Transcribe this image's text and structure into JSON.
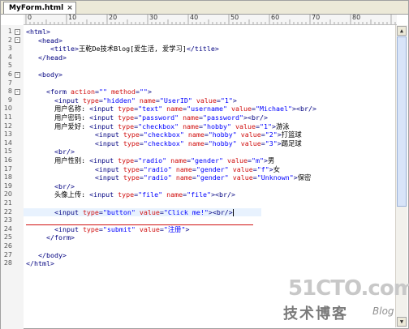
{
  "tab": {
    "title": "MyForm.html",
    "close_glyph": "×"
  },
  "ruler": {
    "labels": [
      "0",
      "10",
      "20",
      "30",
      "40",
      "50",
      "60",
      "70",
      "80"
    ]
  },
  "lines": [
    {
      "n": "1",
      "fold": "-",
      "segs": [
        {
          "c": "tag",
          "t": "<html>"
        }
      ]
    },
    {
      "n": "2",
      "fold": "-",
      "segs": [
        {
          "c": "text",
          "t": "   "
        },
        {
          "c": "tag",
          "t": "<head>"
        }
      ]
    },
    {
      "n": "3",
      "fold": "",
      "segs": [
        {
          "c": "text",
          "t": "      "
        },
        {
          "c": "tag",
          "t": "<title>"
        },
        {
          "c": "text",
          "t": "王乾De技术Blog[爱生活, 爱学习]"
        },
        {
          "c": "tag",
          "t": "</title>"
        }
      ]
    },
    {
      "n": "4",
      "fold": "",
      "segs": [
        {
          "c": "text",
          "t": "   "
        },
        {
          "c": "tag",
          "t": "</head>"
        }
      ]
    },
    {
      "n": "5",
      "fold": "",
      "segs": []
    },
    {
      "n": "6",
      "fold": "-",
      "segs": [
        {
          "c": "text",
          "t": "   "
        },
        {
          "c": "tag",
          "t": "<body>"
        }
      ]
    },
    {
      "n": "7",
      "fold": "",
      "segs": []
    },
    {
      "n": "8",
      "fold": "-",
      "segs": [
        {
          "c": "text",
          "t": "     "
        },
        {
          "c": "tag",
          "t": "<form "
        },
        {
          "c": "attr",
          "t": "action"
        },
        {
          "c": "tag",
          "t": "="
        },
        {
          "c": "val",
          "t": "\"\""
        },
        {
          "c": "text",
          "t": " "
        },
        {
          "c": "attr",
          "t": "method"
        },
        {
          "c": "tag",
          "t": "="
        },
        {
          "c": "val",
          "t": "\"\""
        },
        {
          "c": "tag",
          "t": ">"
        }
      ]
    },
    {
      "n": "9",
      "fold": "",
      "segs": [
        {
          "c": "text",
          "t": "       "
        },
        {
          "c": "tag",
          "t": "<input "
        },
        {
          "c": "attr",
          "t": "type"
        },
        {
          "c": "tag",
          "t": "="
        },
        {
          "c": "val",
          "t": "\"hidden\""
        },
        {
          "c": "text",
          "t": " "
        },
        {
          "c": "attr",
          "t": "name"
        },
        {
          "c": "tag",
          "t": "="
        },
        {
          "c": "val",
          "t": "\"UserID\""
        },
        {
          "c": "text",
          "t": " "
        },
        {
          "c": "attr",
          "t": "value"
        },
        {
          "c": "tag",
          "t": "="
        },
        {
          "c": "val",
          "t": "\"1\""
        },
        {
          "c": "tag",
          "t": ">"
        }
      ]
    },
    {
      "n": "10",
      "fold": "",
      "segs": [
        {
          "c": "text",
          "t": "       用户名称: "
        },
        {
          "c": "tag",
          "t": "<input "
        },
        {
          "c": "attr",
          "t": "type"
        },
        {
          "c": "tag",
          "t": "="
        },
        {
          "c": "val",
          "t": "\"text\""
        },
        {
          "c": "text",
          "t": " "
        },
        {
          "c": "attr",
          "t": "name"
        },
        {
          "c": "tag",
          "t": "="
        },
        {
          "c": "val",
          "t": "\"username\""
        },
        {
          "c": "text",
          "t": " "
        },
        {
          "c": "attr",
          "t": "value"
        },
        {
          "c": "tag",
          "t": "="
        },
        {
          "c": "val",
          "t": "\"Michael\""
        },
        {
          "c": "tag",
          "t": "><br/>"
        }
      ]
    },
    {
      "n": "11",
      "fold": "",
      "segs": [
        {
          "c": "text",
          "t": "       用户密码: "
        },
        {
          "c": "tag",
          "t": "<input "
        },
        {
          "c": "attr",
          "t": "type"
        },
        {
          "c": "tag",
          "t": "="
        },
        {
          "c": "val",
          "t": "\"password\""
        },
        {
          "c": "text",
          "t": " "
        },
        {
          "c": "attr",
          "t": "name"
        },
        {
          "c": "tag",
          "t": "="
        },
        {
          "c": "val",
          "t": "\"password\""
        },
        {
          "c": "tag",
          "t": "><br/>"
        }
      ]
    },
    {
      "n": "12",
      "fold": "",
      "segs": [
        {
          "c": "text",
          "t": "       用户爱好: "
        },
        {
          "c": "tag",
          "t": "<input "
        },
        {
          "c": "attr",
          "t": "type"
        },
        {
          "c": "tag",
          "t": "="
        },
        {
          "c": "val",
          "t": "\"checkbox\""
        },
        {
          "c": "text",
          "t": " "
        },
        {
          "c": "attr",
          "t": "name"
        },
        {
          "c": "tag",
          "t": "="
        },
        {
          "c": "val",
          "t": "\"hobby\""
        },
        {
          "c": "text",
          "t": " "
        },
        {
          "c": "attr",
          "t": "value"
        },
        {
          "c": "tag",
          "t": "="
        },
        {
          "c": "val",
          "t": "\"1\""
        },
        {
          "c": "tag",
          "t": ">"
        },
        {
          "c": "text",
          "t": "游泳"
        }
      ]
    },
    {
      "n": "13",
      "fold": "",
      "segs": [
        {
          "c": "text",
          "t": "                 "
        },
        {
          "c": "tag",
          "t": "<input "
        },
        {
          "c": "attr",
          "t": "type"
        },
        {
          "c": "tag",
          "t": "="
        },
        {
          "c": "val",
          "t": "\"checkbox\""
        },
        {
          "c": "text",
          "t": " "
        },
        {
          "c": "attr",
          "t": "name"
        },
        {
          "c": "tag",
          "t": "="
        },
        {
          "c": "val",
          "t": "\"hobby\""
        },
        {
          "c": "text",
          "t": " "
        },
        {
          "c": "attr",
          "t": "value"
        },
        {
          "c": "tag",
          "t": "="
        },
        {
          "c": "val",
          "t": "\"2\""
        },
        {
          "c": "tag",
          "t": ">"
        },
        {
          "c": "text",
          "t": "打篮球"
        }
      ]
    },
    {
      "n": "14",
      "fold": "",
      "segs": [
        {
          "c": "text",
          "t": "                 "
        },
        {
          "c": "tag",
          "t": "<input "
        },
        {
          "c": "attr",
          "t": "type"
        },
        {
          "c": "tag",
          "t": "="
        },
        {
          "c": "val",
          "t": "\"checkbox\""
        },
        {
          "c": "text",
          "t": " "
        },
        {
          "c": "attr",
          "t": "name"
        },
        {
          "c": "tag",
          "t": "="
        },
        {
          "c": "val",
          "t": "\"hobby\""
        },
        {
          "c": "text",
          "t": " "
        },
        {
          "c": "attr",
          "t": "value"
        },
        {
          "c": "tag",
          "t": "="
        },
        {
          "c": "val",
          "t": "\"3\""
        },
        {
          "c": "tag",
          "t": ">"
        },
        {
          "c": "text",
          "t": "踢足球"
        }
      ]
    },
    {
      "n": "15",
      "fold": "",
      "segs": [
        {
          "c": "text",
          "t": "       "
        },
        {
          "c": "tag",
          "t": "<br/>"
        }
      ]
    },
    {
      "n": "16",
      "fold": "",
      "segs": [
        {
          "c": "text",
          "t": "       用户性别: "
        },
        {
          "c": "tag",
          "t": "<input "
        },
        {
          "c": "attr",
          "t": "type"
        },
        {
          "c": "tag",
          "t": "="
        },
        {
          "c": "val",
          "t": "\"radio\""
        },
        {
          "c": "text",
          "t": " "
        },
        {
          "c": "attr",
          "t": "name"
        },
        {
          "c": "tag",
          "t": "="
        },
        {
          "c": "val",
          "t": "\"gender\""
        },
        {
          "c": "text",
          "t": " "
        },
        {
          "c": "attr",
          "t": "value"
        },
        {
          "c": "tag",
          "t": "="
        },
        {
          "c": "val",
          "t": "\"m\""
        },
        {
          "c": "tag",
          "t": ">"
        },
        {
          "c": "text",
          "t": "男"
        }
      ]
    },
    {
      "n": "17",
      "fold": "",
      "segs": [
        {
          "c": "text",
          "t": "                 "
        },
        {
          "c": "tag",
          "t": "<input "
        },
        {
          "c": "attr",
          "t": "type"
        },
        {
          "c": "tag",
          "t": "="
        },
        {
          "c": "val",
          "t": "\"radio\""
        },
        {
          "c": "text",
          "t": " "
        },
        {
          "c": "attr",
          "t": "name"
        },
        {
          "c": "tag",
          "t": "="
        },
        {
          "c": "val",
          "t": "\"gender\""
        },
        {
          "c": "text",
          "t": " "
        },
        {
          "c": "attr",
          "t": "value"
        },
        {
          "c": "tag",
          "t": "="
        },
        {
          "c": "val",
          "t": "\"f\""
        },
        {
          "c": "tag",
          "t": ">"
        },
        {
          "c": "text",
          "t": "女"
        }
      ]
    },
    {
      "n": "18",
      "fold": "",
      "segs": [
        {
          "c": "text",
          "t": "                 "
        },
        {
          "c": "tag",
          "t": "<input "
        },
        {
          "c": "attr",
          "t": "type"
        },
        {
          "c": "tag",
          "t": "="
        },
        {
          "c": "val",
          "t": "\"radio\""
        },
        {
          "c": "text",
          "t": " "
        },
        {
          "c": "attr",
          "t": "name"
        },
        {
          "c": "tag",
          "t": "="
        },
        {
          "c": "val",
          "t": "\"gender\""
        },
        {
          "c": "text",
          "t": " "
        },
        {
          "c": "attr",
          "t": "value"
        },
        {
          "c": "tag",
          "t": "="
        },
        {
          "c": "val",
          "t": "\"Unknown\""
        },
        {
          "c": "tag",
          "t": ">"
        },
        {
          "c": "text",
          "t": "保密"
        }
      ]
    },
    {
      "n": "19",
      "fold": "",
      "segs": [
        {
          "c": "text",
          "t": "       "
        },
        {
          "c": "tag",
          "t": "<br/>"
        }
      ]
    },
    {
      "n": "20",
      "fold": "",
      "segs": [
        {
          "c": "text",
          "t": "       头像上传: "
        },
        {
          "c": "tag",
          "t": "<input "
        },
        {
          "c": "attr",
          "t": "type"
        },
        {
          "c": "tag",
          "t": "="
        },
        {
          "c": "val",
          "t": "\"file\""
        },
        {
          "c": "text",
          "t": " "
        },
        {
          "c": "attr",
          "t": "name"
        },
        {
          "c": "tag",
          "t": "="
        },
        {
          "c": "val",
          "t": "\"file\""
        },
        {
          "c": "tag",
          "t": "><br/>"
        }
      ]
    },
    {
      "n": "21",
      "fold": "",
      "segs": []
    },
    {
      "n": "22",
      "fold": "",
      "current": true,
      "segs": [
        {
          "c": "text",
          "t": "       "
        },
        {
          "c": "tag",
          "t": "<input "
        },
        {
          "c": "attr",
          "t": "type"
        },
        {
          "c": "tag",
          "t": "="
        },
        {
          "c": "val",
          "t": "\"button\""
        },
        {
          "c": "text",
          "t": " "
        },
        {
          "c": "attr",
          "t": "value"
        },
        {
          "c": "tag",
          "t": "="
        },
        {
          "c": "val",
          "t": "\"Click me!\""
        },
        {
          "c": "tag",
          "t": "><br/>"
        }
      ]
    },
    {
      "n": "23",
      "fold": "",
      "segs": []
    },
    {
      "n": "24",
      "fold": "",
      "segs": [
        {
          "c": "text",
          "t": "       "
        },
        {
          "c": "tag",
          "t": "<input "
        },
        {
          "c": "attr",
          "t": "type"
        },
        {
          "c": "tag",
          "t": "="
        },
        {
          "c": "val",
          "t": "\"submit\""
        },
        {
          "c": "text",
          "t": " "
        },
        {
          "c": "attr",
          "t": "value"
        },
        {
          "c": "tag",
          "t": "="
        },
        {
          "c": "val",
          "t": "\"注册\""
        },
        {
          "c": "tag",
          "t": ">"
        }
      ]
    },
    {
      "n": "25",
      "fold": "",
      "segs": [
        {
          "c": "text",
          "t": "     "
        },
        {
          "c": "tag",
          "t": "</form>"
        }
      ]
    },
    {
      "n": "26",
      "fold": "",
      "segs": []
    },
    {
      "n": "27",
      "fold": "",
      "segs": [
        {
          "c": "text",
          "t": "   "
        },
        {
          "c": "tag",
          "t": "</body>"
        }
      ]
    },
    {
      "n": "28",
      "fold": "",
      "segs": [
        {
          "c": "tag",
          "t": "</html>"
        }
      ]
    }
  ],
  "colors": {
    "tag": "#000080",
    "attr": "#d01010",
    "value": "#0000ff",
    "current_line": "#e8f2fe"
  },
  "watermark": {
    "main": "51CTO.com",
    "sub": "技术博客",
    "blog": "Blog"
  },
  "scrollbar": {
    "up_glyph": "▲",
    "down_glyph": "▼"
  }
}
